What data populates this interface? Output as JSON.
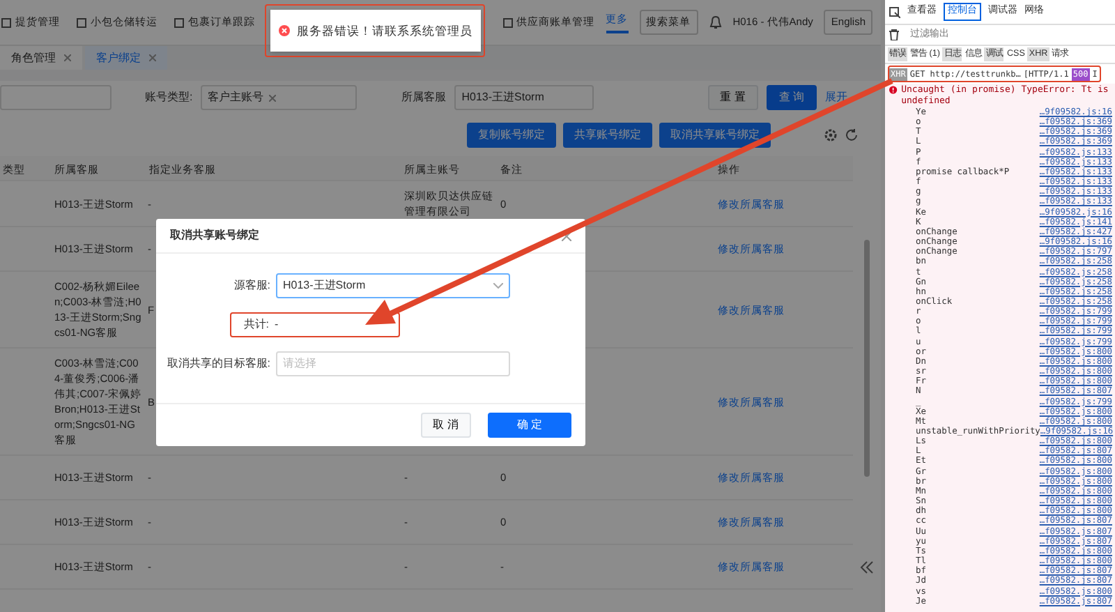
{
  "top_nav": {
    "items": [
      {
        "label": "提货管理"
      },
      {
        "label": "小包仓储转运"
      },
      {
        "label": "包裹订单跟踪"
      },
      {
        "label": "供应商账单管理"
      }
    ],
    "more": {
      "label": "更多",
      "selected": true
    },
    "search_menu": "搜索菜单",
    "user": "H016 - 代伟Andy",
    "language": "English"
  },
  "toast": {
    "message": "服务器错误！请联系系统管理员"
  },
  "tabs": [
    {
      "label": "角色管理",
      "selected": false
    },
    {
      "label": "客户绑定",
      "selected": true
    }
  ],
  "filters": {
    "account_type_label": "账号类型:",
    "account_type_tag": "客户主账号",
    "service_label": "所属客服",
    "service_value": "H013-王进Storm",
    "reset": "重 置",
    "search": "查 询",
    "expand": "展开"
  },
  "actions": [
    "复制账号绑定",
    "共享账号绑定",
    "取消共享账号绑定"
  ],
  "table": {
    "columns": [
      "类型",
      "所属客服",
      "指定业务客服",
      "所属主账号",
      "备注",
      "操作"
    ],
    "rows": [
      {
        "service": "H013-王进Storm",
        "assigned": "-",
        "main_account": "深圳欧贝达供应链管理有限公司",
        "remark": "0",
        "action": "修改所属客服"
      },
      {
        "service": "H013-王进Storm",
        "assigned": "-",
        "action": "修改所属客服"
      },
      {
        "service": "C002-杨秋媚Eileen;C003-林雪涟;H013-王进Storm;Sngcs01-NG客服",
        "assigned": "F",
        "action": "修改所属客服"
      },
      {
        "service": "C003-林雪涟;C004-董俊秀;C006-潘伟其;C007-宋佩婷Bron;H013-王进Storm;Sngcs01-NG客服",
        "assigned": "B",
        "action": "修改所属客服"
      },
      {
        "service": "H013-王进Storm",
        "assigned": "-",
        "main_account": "-",
        "remark": "0",
        "action": "修改所属客服"
      },
      {
        "service": "H013-王进Storm",
        "assigned": "-",
        "main_account": "-",
        "remark": "0",
        "action": "修改所属客服"
      },
      {
        "service": "H013-王进Storm",
        "assigned": "-",
        "main_account": "-",
        "remark": "-",
        "action": "修改所属客服"
      }
    ]
  },
  "modal": {
    "title": "取消共享账号绑定",
    "fields": [
      {
        "kind": "select",
        "label": "源客服:",
        "value": "H013-王进Storm"
      },
      {
        "kind": "text",
        "label": "共计:",
        "value": "-"
      },
      {
        "kind": "select",
        "label": "取消共享的目标客服:",
        "placeholder": "请选择"
      }
    ],
    "cancel": "取 消",
    "confirm": "确 定"
  },
  "devtools": {
    "tabs": [
      {
        "label": "查看器",
        "selected": false
      },
      {
        "label": "控制台",
        "selected": true
      },
      {
        "label": "调试器",
        "selected": false
      },
      {
        "label": "网络",
        "selected": false
      }
    ],
    "filter_placeholder": "过滤输出",
    "levels": [
      {
        "label": "错误",
        "selected": true
      },
      {
        "label": "警告 (1)",
        "selected": false
      },
      {
        "label": "日志",
        "selected": true
      },
      {
        "label": "信息",
        "selected": false
      },
      {
        "label": "调试",
        "selected": true
      },
      {
        "label": "CSS",
        "selected": false
      },
      {
        "label": "XHR",
        "selected": true
      },
      {
        "label": "请求",
        "selected": false
      }
    ],
    "request": {
      "tag": "XHR",
      "text": "GET http://testtrunkb…",
      "protocol": "[HTTP/1.1",
      "status": "500",
      "rest": "I"
    },
    "error": "Uncaught (in promise) TypeError: Tt is undefined",
    "frames": [
      {
        "name": "Ye",
        "file": "…9f09582.js:16"
      },
      {
        "name": "o",
        "file": "…f09582.js:369"
      },
      {
        "name": "T",
        "file": "…f09582.js:369"
      },
      {
        "name": "L",
        "file": "…f09582.js:369"
      },
      {
        "name": "P",
        "file": "…f09582.js:133"
      },
      {
        "name": "f",
        "file": "…f09582.js:133"
      },
      {
        "name": "promise callback*P",
        "file": "…f09582.js:133"
      },
      {
        "name": "f",
        "file": "…f09582.js:133"
      },
      {
        "name": "g",
        "file": "…f09582.js:133"
      },
      {
        "name": "g",
        "file": "…f09582.js:133"
      },
      {
        "name": "Ke",
        "file": "…9f09582.js:16"
      },
      {
        "name": "K",
        "file": "…f09582.js:141"
      },
      {
        "name": "onChange",
        "file": "…f09582.js:427"
      },
      {
        "name": "onChange",
        "file": "…9f09582.js:16"
      },
      {
        "name": "onChange",
        "file": "…f09582.js:797"
      },
      {
        "name": "bn",
        "file": "…f09582.js:258"
      },
      {
        "name": "t",
        "file": "…f09582.js:258"
      },
      {
        "name": "Gn",
        "file": "…f09582.js:258"
      },
      {
        "name": "hn",
        "file": "…f09582.js:258"
      },
      {
        "name": "onClick",
        "file": "…f09582.js:258"
      },
      {
        "name": "r",
        "file": "…f09582.js:799"
      },
      {
        "name": "o",
        "file": "…f09582.js:799"
      },
      {
        "name": "l",
        "file": "…f09582.js:799"
      },
      {
        "name": "u",
        "file": "…f09582.js:799"
      },
      {
        "name": "or",
        "file": "…f09582.js:800"
      },
      {
        "name": "Dn",
        "file": "…f09582.js:800"
      },
      {
        "name": "sr",
        "file": "…f09582.js:800"
      },
      {
        "name": "Fr",
        "file": "…f09582.js:800"
      },
      {
        "name": "N",
        "file": "…f09582.js:807"
      },
      {
        "name": "_",
        "file": "…f09582.js:799"
      },
      {
        "name": "Xe",
        "file": "…f09582.js:800"
      },
      {
        "name": "Mt",
        "file": "…f09582.js:800"
      },
      {
        "name": "unstable_runWithPriority",
        "file": "…9f09582.js:16"
      },
      {
        "name": "Ls",
        "file": "…f09582.js:800"
      },
      {
        "name": "L",
        "file": "…f09582.js:807"
      },
      {
        "name": "Et",
        "file": "…f09582.js:800"
      },
      {
        "name": "Gr",
        "file": "…f09582.js:800"
      },
      {
        "name": "br",
        "file": "…f09582.js:800"
      },
      {
        "name": "Mn",
        "file": "…f09582.js:800"
      },
      {
        "name": "Sn",
        "file": "…f09582.js:800"
      },
      {
        "name": "dh",
        "file": "…f09582.js:800"
      },
      {
        "name": "cc",
        "file": "…f09582.js:807"
      },
      {
        "name": "Uu",
        "file": "…f09582.js:807"
      },
      {
        "name": "yu",
        "file": "…f09582.js:807"
      },
      {
        "name": "Ts",
        "file": "…f09582.js:800"
      },
      {
        "name": "Tl",
        "file": "…f09582.js:800"
      },
      {
        "name": "bf",
        "file": "…f09582.js:807"
      },
      {
        "name": "Jd",
        "file": "…f09582.js:807"
      },
      {
        "name": "vs",
        "file": "…f09582.js:800"
      },
      {
        "name": "Je",
        "file": "…f09582.js:807"
      }
    ]
  }
}
